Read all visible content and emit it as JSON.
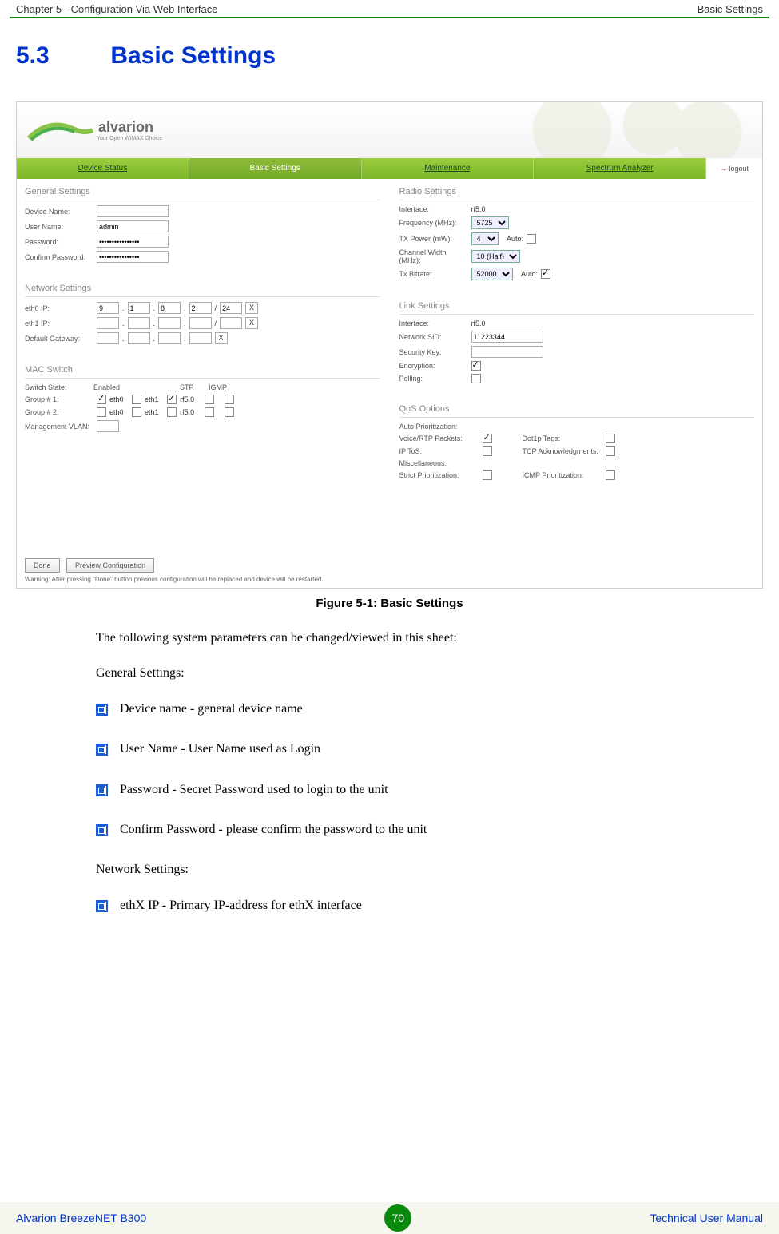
{
  "header": {
    "left": "Chapter 5 - Configuration Via Web Interface",
    "right": "Basic Settings"
  },
  "section": {
    "number": "5.3",
    "title": "Basic Settings"
  },
  "screenshot": {
    "logo_brand": "alvarion",
    "logo_tag": "Your Open WiMAX Choice",
    "nav": {
      "items": [
        "Device Status",
        "Basic Settings",
        "Maintenance",
        "Spectrum Analyzer"
      ],
      "active_index": 1,
      "logout": "logout"
    },
    "general": {
      "title": "General Settings",
      "device_name_label": "Device Name:",
      "device_name_value": "",
      "user_name_label": "User Name:",
      "user_name_value": "admin",
      "password_label": "Password:",
      "password_value": "••••••••••••••••",
      "confirm_label": "Confirm Password:",
      "confirm_value": "••••••••••••••••"
    },
    "radio": {
      "title": "Radio Settings",
      "interface_label": "Interface:",
      "interface_value": "rf5.0",
      "freq_label": "Frequency (MHz):",
      "freq_value": "5725",
      "txpower_label": "TX Power (mW):",
      "txpower_value": "4",
      "txpower_auto_label": "Auto:",
      "chwidth_label": "Channel Width (MHz):",
      "chwidth_value": "10 (Half)",
      "bitrate_label": "Tx Bitrate:",
      "bitrate_value": "52000",
      "bitrate_auto_label": "Auto:"
    },
    "network": {
      "title": "Network Settings",
      "eth0_label": "eth0 IP:",
      "eth0_oct": [
        "9",
        "1",
        "8",
        "2"
      ],
      "eth0_mask": "24",
      "eth1_label": "eth1 IP:",
      "eth1_oct": [
        "",
        "",
        "",
        ""
      ],
      "gw_label": "Default Gateway:",
      "gw_oct": [
        "",
        "",
        "",
        ""
      ]
    },
    "link": {
      "title": "Link Settings",
      "interface_label": "Interface:",
      "interface_value": "rf5.0",
      "sid_label": "Network SID:",
      "sid_value": "11223344",
      "seckey_label": "Security Key:",
      "seckey_value": "",
      "enc_label": "Encryption:",
      "poll_label": "Polling:"
    },
    "mac": {
      "title": "MAC Switch",
      "state_label": "Switch State:",
      "state_value": "Enabled",
      "hdr_stp": "STP",
      "hdr_igmp": "IGMP",
      "g1_label": "Group # 1:",
      "g2_label": "Group # 2:",
      "if_eth0": "eth0",
      "if_eth1": "eth1",
      "if_rf": "rf5.0",
      "vlan_label": "Management VLAN:"
    },
    "qos": {
      "title": "QoS Options",
      "auto_label": "Auto Prioritization:",
      "voice_label": "Voice/RTP Packets:",
      "dot1p_label": "Dot1p Tags:",
      "iptos_label": "IP ToS:",
      "tcpack_label": "TCP Acknowledgments:",
      "misc_label": "Miscellaneous:",
      "strict_label": "Strict Prioritization:",
      "icmp_label": "ICMP Prioritization:"
    },
    "footer": {
      "done": "Done",
      "preview": "Preview Configuration",
      "warning": "Warning: After pressing \"Done\" button previous configuration will be replaced and device will be restarted."
    }
  },
  "figure_caption": "Figure 5-1: Basic Settings",
  "body": {
    "intro": "The following system parameters can be changed/viewed in this sheet:",
    "general_heading": "General Settings:",
    "general_bullets": [
      "Device name - general device name",
      "User Name - User Name used as Login",
      "Password - Secret Password used to login to the unit",
      "Confirm Password - please confirm the password to the unit"
    ],
    "network_heading": "Network Settings:",
    "network_bullets": [
      "ethX IP - Primary IP-address for ethX interface"
    ]
  },
  "footer": {
    "left": "Alvarion BreezeNET B300",
    "page": "70",
    "right": "Technical User Manual"
  }
}
